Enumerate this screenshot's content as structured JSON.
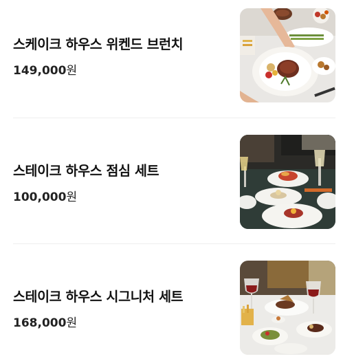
{
  "menu": {
    "items": [
      {
        "name": "스케이크 하우스 위켄드 브런치",
        "price_value": "149,000",
        "price_unit": "원",
        "image": "steak-brunch-photo"
      },
      {
        "name": "스테이크 하우스 점심 세트",
        "price_value": "100,000",
        "price_unit": "원",
        "image": "lunch-set-photo"
      },
      {
        "name": "스테이크 하우스 시그니처 세트",
        "price_value": "168,000",
        "price_unit": "원",
        "image": "signature-set-photo"
      }
    ]
  },
  "colors": {
    "text": "#111111",
    "divider": "#eeeeee",
    "background": "#ffffff"
  }
}
